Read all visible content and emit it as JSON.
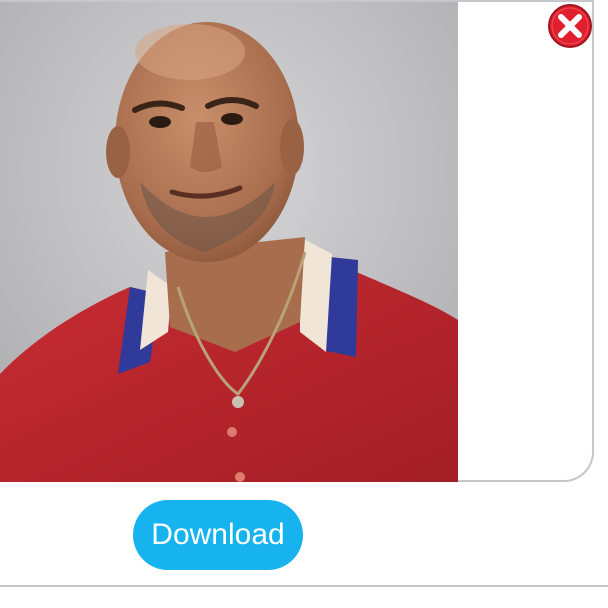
{
  "dialog": {
    "photo": {
      "icon": "portrait-photo",
      "background_color": "#b9b9bb",
      "shirt_color": "#c0262c",
      "collar_color": "#2f3a9a"
    },
    "close_button": {
      "icon": "close-icon",
      "color": "#e0202e"
    },
    "download_button": {
      "label": "Download",
      "color": "#17b3ee"
    }
  }
}
